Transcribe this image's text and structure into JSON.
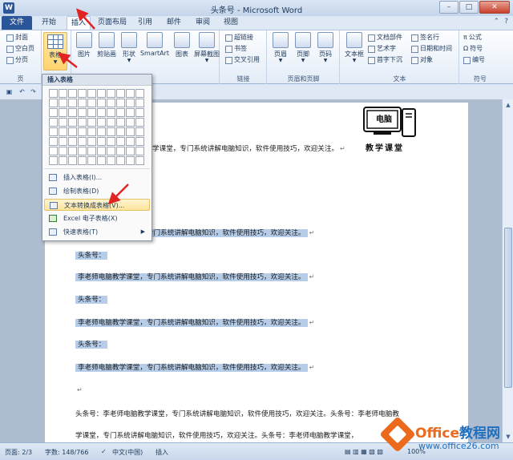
{
  "window": {
    "title": "头条号 - Microsoft Word",
    "app_icon": "W",
    "minimize": "–",
    "maximize": "□",
    "close": "✕"
  },
  "quick_access": [
    "save-icon",
    "undo-icon",
    "redo-icon"
  ],
  "tabs": [
    {
      "label": "文件",
      "state": "file"
    },
    {
      "label": "开始",
      "state": "normal"
    },
    {
      "label": "插入",
      "state": "active"
    },
    {
      "label": "页面布局",
      "state": "normal"
    },
    {
      "label": "引用",
      "state": "normal"
    },
    {
      "label": "邮件",
      "state": "normal"
    },
    {
      "label": "审阅",
      "state": "normal"
    },
    {
      "label": "视图",
      "state": "normal"
    }
  ],
  "ribbon": {
    "pages_group": {
      "items": [
        "封面",
        "空白页",
        "分页"
      ],
      "label": "页"
    },
    "tables_group": {
      "table_label": "表格"
    },
    "illustrations_group": {
      "items": [
        "图片",
        "剪贴画",
        "形状",
        "SmartArt",
        "图表",
        "屏幕截图"
      ]
    },
    "links_group": {
      "items": [
        "超链接",
        "书签",
        "交叉引用"
      ],
      "label": "链接"
    },
    "header_footer_group": {
      "items": [
        "页眉",
        "页脚",
        "页码"
      ],
      "label": "页眉和页脚"
    },
    "text_group": {
      "text_box": "文本框",
      "items": [
        "文档部件",
        "艺术字",
        "首字下沉",
        "签名行",
        "日期和时间",
        "对象"
      ],
      "label": "文本"
    },
    "symbols_group": {
      "items": [
        "公式",
        "符号",
        "编号"
      ],
      "label": "符号"
    }
  },
  "table_menu": {
    "header": "插入表格",
    "grid_cols": 10,
    "grid_rows": 8,
    "items": [
      {
        "label": "插入表格(I)...",
        "icon": "insert-table-icon"
      },
      {
        "label": "绘制表格(D)",
        "icon": "draw-table-icon"
      },
      {
        "label": "文本转换成表格(V)...",
        "icon": "convert-text-icon",
        "highlighted": true
      },
      {
        "label": "Excel 电子表格(X)",
        "icon": "excel-icon"
      },
      {
        "label": "快速表格(T)",
        "icon": "quick-table-icon",
        "submenu": true
      }
    ]
  },
  "document": {
    "logo_label": "电脑",
    "logo_sub": "教学课堂",
    "first_line_tail": "学课堂，专门系统讲解电脑知识，软件使用技巧，欢迎关注。",
    "lines": [
      {
        "text": "李老师电脑教学课堂，专门系统讲解电脑知识，软件使用技巧，欢迎关注。",
        "highlighted": true
      },
      {
        "text": "头条号：",
        "highlighted": true
      },
      {
        "text": "李老师电脑教学课堂，专门系统讲解电脑知识，软件使用技巧，欢迎关注。",
        "highlighted": true
      },
      {
        "text": "头条号：",
        "highlighted": true
      },
      {
        "text": "李老师电脑教学课堂，专门系统讲解电脑知识，软件使用技巧，欢迎关注。",
        "highlighted": true
      },
      {
        "text": "头条号：",
        "highlighted": true
      },
      {
        "text": "李老师电脑教学课堂，专门系统讲解电脑知识，软件使用技巧，欢迎关注。",
        "highlighted": true
      }
    ],
    "para_mark": "↵",
    "bottom_line_1": "头条号：李老师电脑教学课堂，专门系统讲解电脑知识，软件使用技巧，欢迎关注。头条号：李老师电脑教",
    "bottom_line_2": "学课堂，专门系统讲解电脑知识，软件使用技巧，欢迎关注。头条号：李老师电脑教学课堂，"
  },
  "statusbar": {
    "page": "页面: 2/3",
    "words": "字数: 148/766",
    "language": "中文(中国)",
    "mode": "插入",
    "zoom": "100%"
  },
  "watermark": {
    "brand_a": "Office",
    "brand_b": "教程网",
    "url": "www.office26.com"
  }
}
